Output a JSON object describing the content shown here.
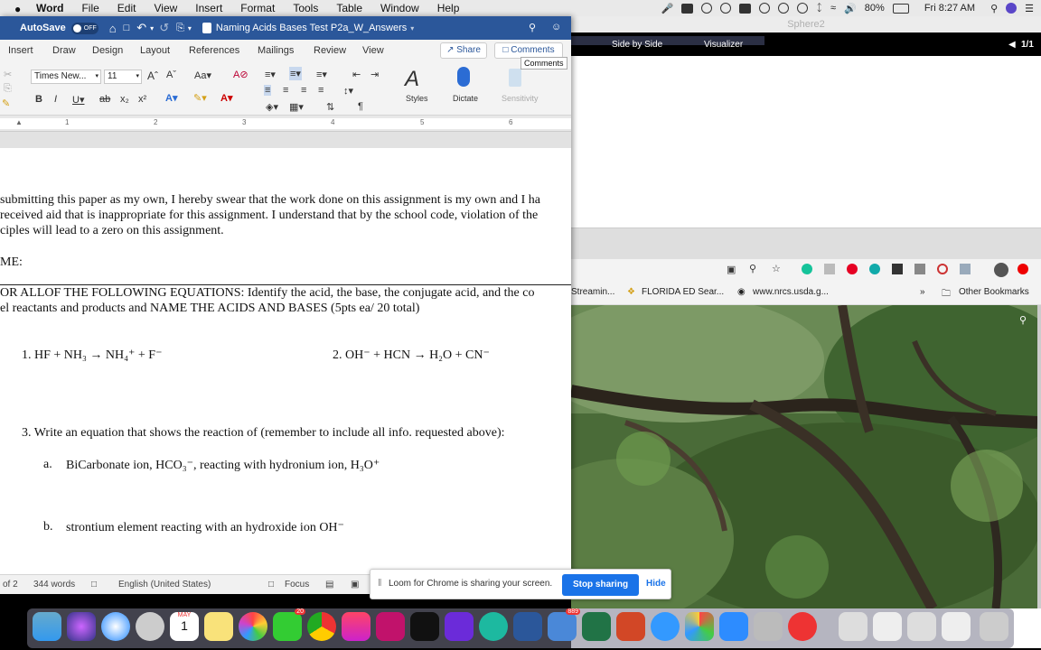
{
  "menubar": {
    "app": "Word",
    "items": [
      "File",
      "Edit",
      "View",
      "Insert",
      "Format",
      "Tools",
      "Table",
      "Window",
      "Help"
    ],
    "battery": "80%",
    "clock": "Fri 8:27 AM"
  },
  "word": {
    "autosave_label": "AutoSave",
    "autosave_state": "OFF",
    "doc_title": "Naming Acids Bases Test P2a_W_Answers",
    "tabs": [
      "Insert",
      "Draw",
      "Design",
      "Layout",
      "References",
      "Mailings",
      "Review",
      "View"
    ],
    "share_label": "Share",
    "comments_label": "Comments",
    "tooltip": "Comments",
    "font_name": "Times New...",
    "font_size": "11",
    "styles_label": "Styles",
    "dictate_label": "Dictate",
    "sensitivity_label": "Sensitivity",
    "ruler_marks": [
      "1",
      "2",
      "3",
      "4",
      "5",
      "6"
    ]
  },
  "document": {
    "lines": [
      "submitting this paper as my own, I hereby swear that the work done on this assignment is my own and I ha",
      "received aid that is inappropriate for this assignment. I understand that by the school code, violation of the",
      "ciples will lead to a zero on this assignment.",
      "ME:",
      "OR ALLOF THE FOLLOWING EQUATIONS: Identify the acid, the base, the conjugate acid, and the co",
      "el reactants and products and NAME THE ACIDS AND BASES (5pts ea/ 20 total)",
      "1. HF + NH₃ → NH₄⁺ + F⁻",
      "2. OH⁻ + HCN → H₂O + CN⁻",
      "3. Write an equation that shows the reaction of (remember to include all info. requested above):",
      "a.",
      "BiCarbonate ion, HCO₃⁻, reacting with hydronium ion, H₃O⁺",
      "b.",
      "strontium element reacting with an hydroxide ion OH⁻"
    ]
  },
  "statusbar": {
    "page": "of 2",
    "words": "344 words",
    "language": "English (United States)",
    "focus": "Focus"
  },
  "sphere": {
    "title": "Sphere2",
    "side_by_side": "Side by Side",
    "visualizer": "Visualizer",
    "page": "1/1"
  },
  "chrome": {
    "bookmarks": [
      "Streamin...",
      "FLORIDA ED Sear...",
      "www.nrcs.usda.g...",
      "»",
      "Other Bookmarks"
    ]
  },
  "loom": {
    "message": "Loom for Chrome is sharing your screen.",
    "stop": "Stop sharing",
    "hide": "Hide"
  },
  "dock": {
    "calendar_month": "MAY",
    "calendar_day": "1",
    "badges": [
      "20",
      "889"
    ]
  }
}
